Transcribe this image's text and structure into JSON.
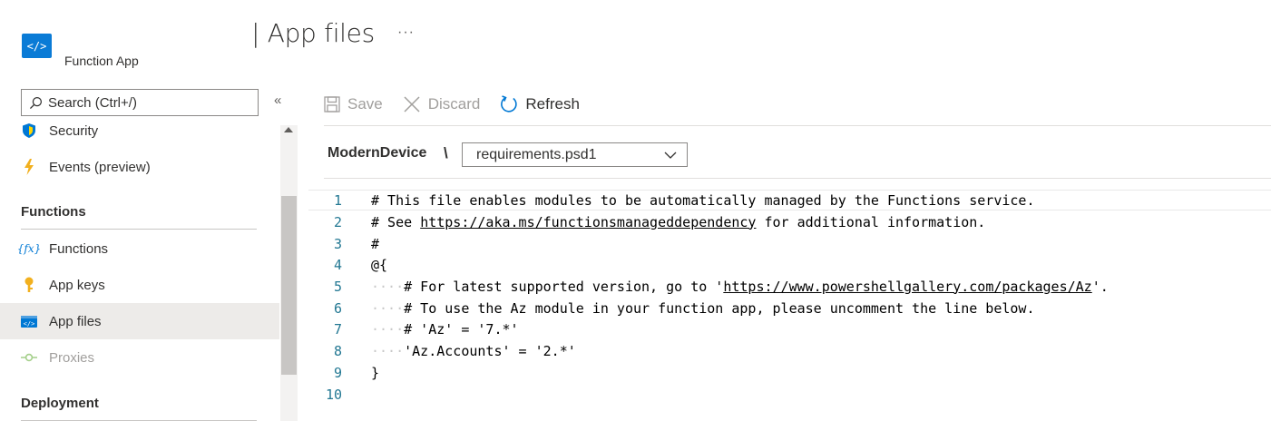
{
  "header": {
    "title": "| App files",
    "subtitle": "Function App",
    "more": "···"
  },
  "sidebar": {
    "search_placeholder": "Search (Ctrl+/)",
    "collapse": "«",
    "items": [
      {
        "label": "Security",
        "icon": "shield-icon"
      },
      {
        "label": "Events (preview)",
        "icon": "lightning-icon"
      },
      {
        "section": "Functions"
      },
      {
        "label": "Functions",
        "icon": "function-icon"
      },
      {
        "label": "App keys",
        "icon": "key-icon"
      },
      {
        "label": "App files",
        "icon": "code-icon",
        "active": true
      },
      {
        "label": "Proxies",
        "icon": "proxy-icon",
        "disabled": true
      },
      {
        "section": "Deployment"
      }
    ]
  },
  "toolbar": {
    "save": "Save",
    "discard": "Discard",
    "refresh": "Refresh"
  },
  "file_selector": {
    "path": "ModernDevice",
    "separator": "\\",
    "selected": "requirements.psd1"
  },
  "editor": {
    "lines": [
      {
        "n": "1",
        "text": "# This file enables modules to be automatically managed by the Functions service."
      },
      {
        "n": "2",
        "text": "# See https://aka.ms/functionsmanageddependency for additional information."
      },
      {
        "n": "3",
        "text": "#"
      },
      {
        "n": "4",
        "text": "@{"
      },
      {
        "n": "5",
        "text": "    # For latest supported version, go to 'https://www.powershellgallery.com/packages/Az'. "
      },
      {
        "n": "6",
        "text": "    # To use the Az module in your function app, please uncomment the line below."
      },
      {
        "n": "7",
        "text": "    # 'Az' = '7.*'"
      },
      {
        "n": "8",
        "text": "    'Az.Accounts' = '2.*'"
      },
      {
        "n": "9",
        "text": "}"
      },
      {
        "n": "10",
        "text": ""
      }
    ]
  },
  "colors": {
    "accent": "#0078d4",
    "line_number": "#237893",
    "active_bg": "#edebe9"
  }
}
